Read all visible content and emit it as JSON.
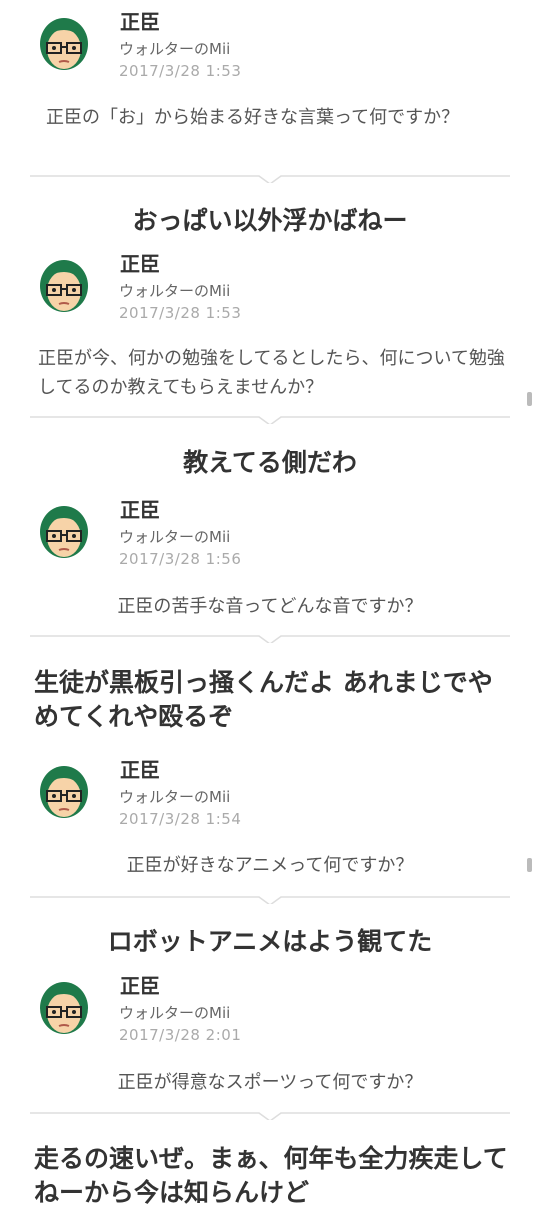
{
  "posts": [
    {
      "name": "正臣",
      "subtitle": "ウォルターのMii",
      "timestamp": "2017/3/28  1:53",
      "question": "正臣の「お」から始まる好きな言葉って何ですか？",
      "answer": "おっぱい以外浮かばねー"
    },
    {
      "name": "正臣",
      "subtitle": "ウォルターのMii",
      "timestamp": "2017/3/28  1:53",
      "question": "正臣が今、何かの勉強をしてるとしたら、何について勉強してるのか教えてもらえませんか？",
      "answer": "教えてる側だわ"
    },
    {
      "name": "正臣",
      "subtitle": "ウォルターのMii",
      "timestamp": "2017/3/28  1:56",
      "question": "正臣の苦手な音ってどんな音ですか？",
      "answer": "生徒が黒板引っ掻くんだよ あれまじでやめてくれや殴るぞ"
    },
    {
      "name": "正臣",
      "subtitle": "ウォルターのMii",
      "timestamp": "2017/3/28  1:54",
      "question": "正臣が好きなアニメって何ですか？",
      "answer": "ロボットアニメはよう観てた"
    },
    {
      "name": "正臣",
      "subtitle": "ウォルターのMii",
      "timestamp": "2017/3/28  2:01",
      "question": "正臣が得意なスポーツって何ですか？",
      "answer": "走るの速いぜ。まぁ、何年も全力疾走してねーから今は知らんけど"
    }
  ],
  "colors": {
    "hair": "#1f7a4a",
    "skin": "#f7d3a8",
    "divider": "#dddddd",
    "question_text": "#555555",
    "answer_text": "#333333"
  },
  "icons": {
    "avatar": "mii-avatar-icon",
    "divider": "speech-pointer-divider"
  }
}
